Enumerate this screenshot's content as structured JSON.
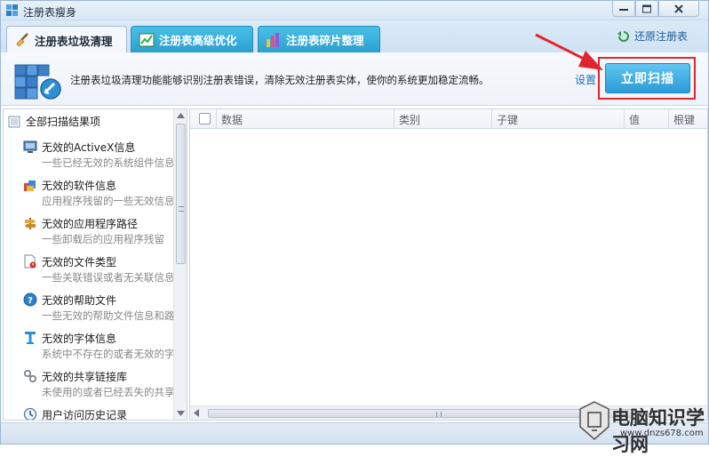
{
  "window": {
    "title": "注册表瘦身",
    "controls": [
      "minimize",
      "maximize",
      "close"
    ]
  },
  "tabs": [
    {
      "label": "注册表垃圾清理",
      "icon": "broom-icon",
      "active": true
    },
    {
      "label": "注册表高级优化",
      "icon": "chart-icon",
      "active": false
    },
    {
      "label": "注册表碎片整理",
      "icon": "defrag-icon",
      "active": false
    }
  ],
  "restore": {
    "label": "还原注册表",
    "icon": "restore-icon"
  },
  "header": {
    "description": "注册表垃圾清理功能能够识别注册表错误，清除无效注册表实体，使你的系统更加稳定流畅。",
    "settings_label": "设置",
    "scan_button_label": "立即扫描"
  },
  "tree": {
    "root_label": "全部扫描结果项",
    "items": [
      {
        "title": "无效的ActiveX信息",
        "subtitle": "一些已经无效的系统组件信息",
        "icon": "activex-icon"
      },
      {
        "title": "无效的软件信息",
        "subtitle": "应用程序残留的一些无效信息",
        "icon": "software-icon"
      },
      {
        "title": "无效的应用程序路径",
        "subtitle": "一些卸载后的应用程序残留",
        "icon": "app-path-icon"
      },
      {
        "title": "无效的文件类型",
        "subtitle": "一些关联错误或者无关联信息",
        "icon": "file-type-icon"
      },
      {
        "title": "无效的帮助文件",
        "subtitle": "一些无效的帮助文件信息和路径",
        "icon": "help-icon"
      },
      {
        "title": "无效的字体信息",
        "subtitle": "系统中不存在的或者无效的字体",
        "icon": "font-icon"
      },
      {
        "title": "无效的共享链接库",
        "subtitle": "未使用的或者已经丢失的共享库",
        "icon": "dll-icon"
      },
      {
        "title": "用户访问历史记录",
        "subtitle": "",
        "icon": "history-icon"
      }
    ]
  },
  "table": {
    "columns": [
      "数据",
      "类别",
      "子键",
      "值",
      "根键"
    ],
    "rows": []
  },
  "watermark": {
    "title": "电脑知识学习网",
    "url": "www.dnzs678.com"
  },
  "colors": {
    "accent": "#2a9bd8",
    "tab_inactive": "#3aaedb",
    "highlight_frame": "#e0262c",
    "link": "#1a6fbf"
  }
}
